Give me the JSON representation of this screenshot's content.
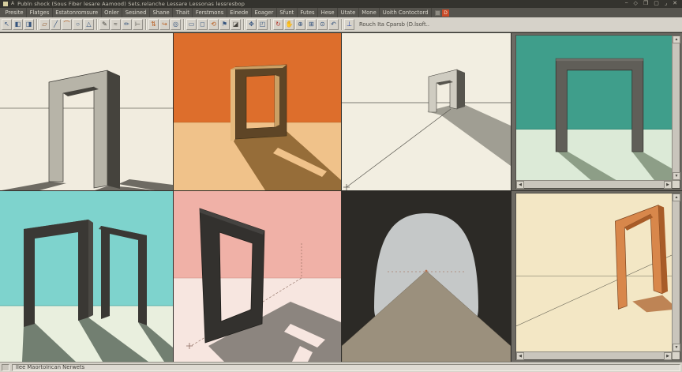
{
  "window": {
    "title": "Publn shock (Sous Fiber lesare Aamood) Sets.relanche   Lessare Lessonas lessresbop",
    "app_glyph": "A",
    "controls": [
      {
        "name": "minimize-button",
        "glyph": "−"
      },
      {
        "name": "unpin-button",
        "glyph": "◇"
      },
      {
        "name": "restore-button",
        "glyph": "❐"
      },
      {
        "name": "maximize-button",
        "glyph": "▢"
      },
      {
        "name": "resize-button",
        "glyph": "⌟"
      },
      {
        "name": "close-button",
        "glyph": "✕"
      }
    ]
  },
  "menu": {
    "items": [
      "Presite",
      "Flatges",
      "Estatonromsure",
      "Onler",
      "Sesined",
      "Shane",
      "Thait",
      "Ferstmons",
      "Einede",
      "Eoager",
      "Sfunt",
      "Futes",
      "Hese",
      "Utate",
      "Mone",
      "Uoith Contoctord"
    ],
    "badge": "D"
  },
  "toolbar": {
    "hint": "Rouch Ita Cparsb (D.lsoft..",
    "groups": [
      [
        {
          "name": "select-tool",
          "glyph": "↖",
          "color": "#35547e"
        },
        {
          "name": "make-component-tool",
          "glyph": "◧",
          "color": "#35547e"
        },
        {
          "name": "paint-bucket-tool",
          "glyph": "◨",
          "color": "#35547e"
        }
      ],
      [
        {
          "name": "eraser-tool",
          "glyph": "▱",
          "color": "#8a4a1a"
        },
        {
          "name": "line-tool",
          "glyph": "╱",
          "color": "#35547e"
        },
        {
          "name": "arc-tool",
          "glyph": "⌒",
          "color": "#b85c1e"
        },
        {
          "name": "circle-tool",
          "glyph": "○",
          "color": "#35547e"
        },
        {
          "name": "polygon-tool",
          "glyph": "△",
          "color": "#35547e"
        }
      ],
      [
        {
          "name": "pencil-tool",
          "glyph": "✎",
          "color": "#44423c"
        },
        {
          "name": "freehand-tool",
          "glyph": "≈",
          "color": "#44423c"
        },
        {
          "name": "dimension-tool",
          "glyph": "✏",
          "color": "#35547e"
        },
        {
          "name": "tape-measure-tool",
          "glyph": "⊢",
          "color": "#44423c"
        }
      ],
      [
        {
          "name": "push-pull-tool",
          "glyph": "⇅",
          "color": "#b85c1e"
        },
        {
          "name": "follow-me-tool",
          "glyph": "↪",
          "color": "#b85c1e"
        },
        {
          "name": "offset-tool",
          "glyph": "◎",
          "color": "#35547e"
        }
      ],
      [
        {
          "name": "rectangle-tool",
          "glyph": "▭",
          "color": "#35547e"
        },
        {
          "name": "box-tool",
          "glyph": "◻",
          "color": "#35547e"
        },
        {
          "name": "rotate-tool",
          "glyph": "⟲",
          "color": "#b85c1e"
        },
        {
          "name": "text-tool",
          "glyph": "⚑",
          "color": "#35547e"
        },
        {
          "name": "section-plane-tool",
          "glyph": "◪",
          "color": "#44423c"
        }
      ],
      [
        {
          "name": "move-tool",
          "glyph": "✥",
          "color": "#35547e"
        },
        {
          "name": "scale-tool",
          "glyph": "◰",
          "color": "#35547e"
        }
      ],
      [
        {
          "name": "orbit-tool",
          "glyph": "↻",
          "color": "#b5342a"
        },
        {
          "name": "pan-tool",
          "glyph": "✋",
          "color": "#35547e"
        },
        {
          "name": "zoom-tool",
          "glyph": "⊕",
          "color": "#35547e"
        },
        {
          "name": "zoom-window-tool",
          "glyph": "⊞",
          "color": "#35547e"
        },
        {
          "name": "zoom-extents-tool",
          "glyph": "⊙",
          "color": "#35547e"
        },
        {
          "name": "previous-view-tool",
          "glyph": "↶",
          "color": "#35547e"
        }
      ],
      [
        {
          "name": "axes-tool",
          "glyph": "⊥",
          "color": "#2244aa"
        }
      ]
    ]
  },
  "statusbar": {
    "message": "Ilee Maortolrican Nerwets"
  },
  "viewports": [
    {
      "id": "viewport-1",
      "description": "gray portal arch on cream ground, shadows toward viewer",
      "colors": {
        "bg": "#f1ecdf",
        "object": "#b7b4a8",
        "object_dark": "#45433d",
        "object_light": "#c8c5b9",
        "shadow": "#57554d",
        "line": "#6a675e"
      }
    },
    {
      "id": "viewport-2",
      "description": "brown rectangular frame, orange wall and tan floor, long shadow right",
      "colors": {
        "wall": "#dd6e2c",
        "floor": "#f0c28a",
        "frame": "#5e4526",
        "frame_light": "#e3b97d",
        "frame_mid": "#caa065",
        "shadow": "#7c5422"
      }
    },
    {
      "id": "viewport-3",
      "description": "small gray arch on cream ground with large cast shadow",
      "colors": {
        "bg": "#f2eee1",
        "object": "#cfccc1",
        "object_dark": "#57554e",
        "object_light": "#dcd9cf",
        "shadow": "#8b897f",
        "line": "#55534c"
      }
    },
    {
      "id": "viewport-4",
      "description": "dark gray portal frame, teal wall, pale floor (window with scrollbars)",
      "colors": {
        "wall": "#3f9e8b",
        "floor": "#dcead7",
        "object": "#605e58",
        "object_light": "#716f69",
        "shadow": "#7f9179",
        "line": "#2e7a6a"
      }
    },
    {
      "id": "viewport-5",
      "description": "two dark portal arches, aqua wall, pale green floor",
      "colors": {
        "wall": "#7ed3cd",
        "floor": "#e9efde",
        "object": "#3a3834",
        "object_side": "#4a4843",
        "shadow": "#5d6b5e",
        "line": "#4aa69e"
      }
    },
    {
      "id": "viewport-6",
      "description": "dark rectangular frame, pink wall, pale pink floor, big shadow",
      "colors": {
        "wall": "#f0b1a7",
        "floor": "#f7e6e0",
        "object": "#33312e",
        "object_light": "#454340",
        "shadow": "#716d67",
        "line": "#c4867c"
      }
    },
    {
      "id": "viewport-7",
      "description": "light dome and tan pyramid on dark background",
      "colors": {
        "bg": "#2c2a26",
        "dome": "#c5c8c8",
        "ground": "#9b907d",
        "line": "#a5705a",
        "dot": "#b5714f"
      }
    },
    {
      "id": "viewport-8",
      "description": "orange portal frame on cream ground (window with scrollbars)",
      "colors": {
        "bg": "#f3e7c5",
        "frame": "#d8874b",
        "frame_dark": "#a85c28",
        "frame_light": "#ecb277",
        "shadow": "#b06b38",
        "line": "#6a6758"
      }
    }
  ]
}
